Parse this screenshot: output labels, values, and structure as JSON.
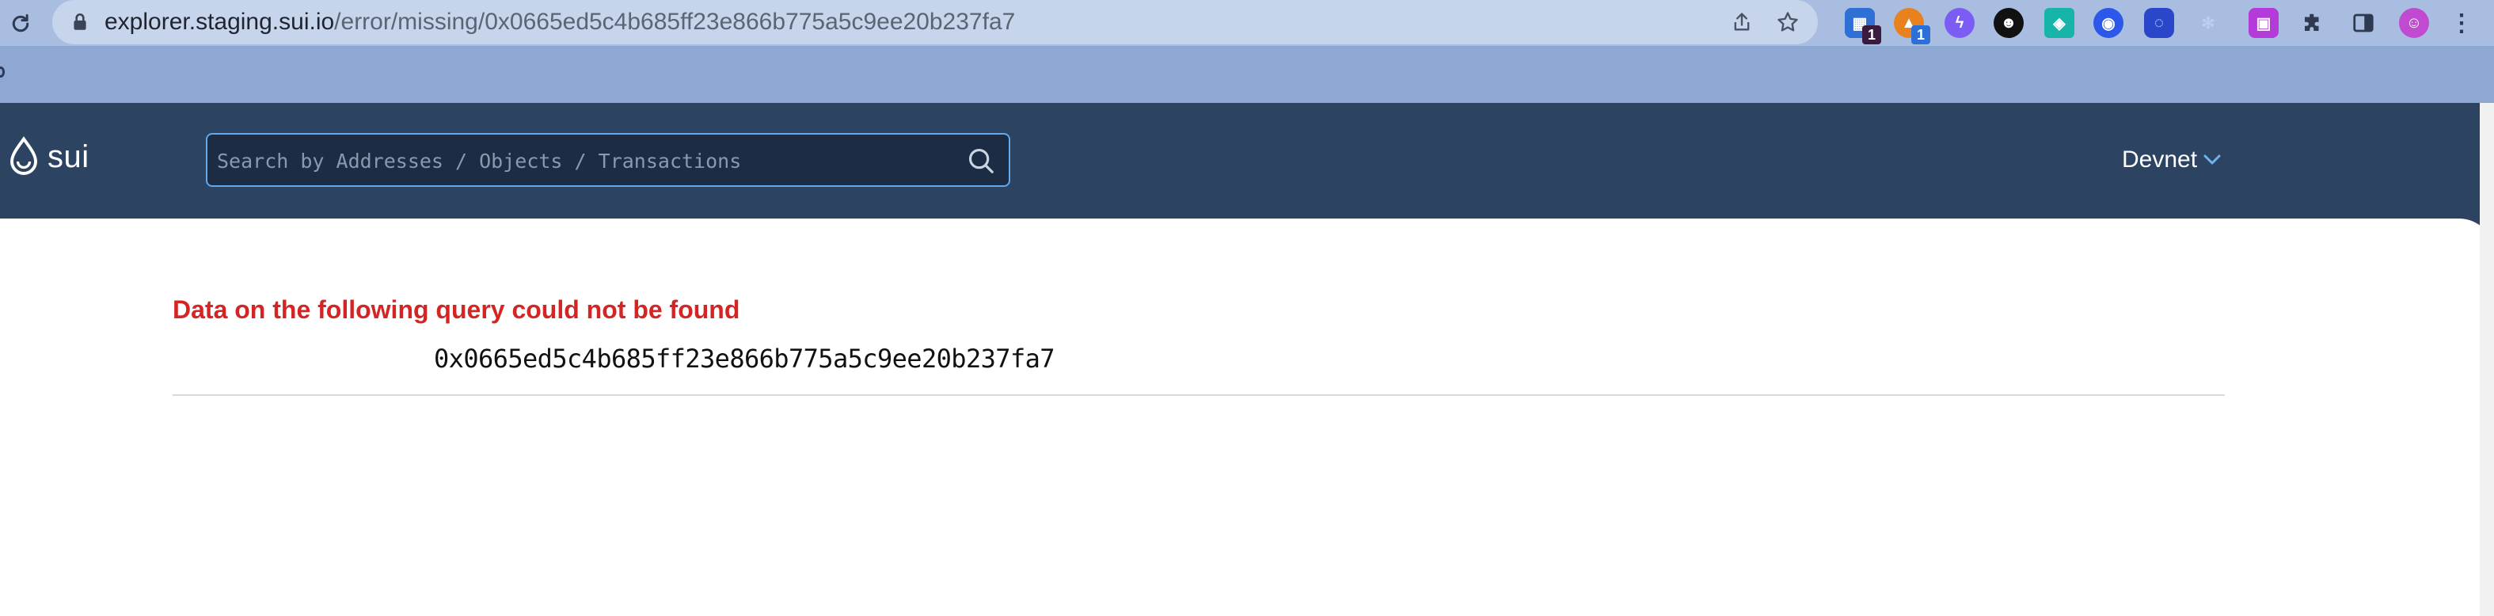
{
  "browser": {
    "url_host": "explorer.staging.sui.io",
    "url_path": "/error/missing/0x0665ed5c4b685ff23e866b775a5c9ee20b237fa7",
    "extensions": [
      {
        "name": "extension-grid-icon",
        "color": "#2f6fd6",
        "badge": "1",
        "badge_color": "#3a1a3f"
      },
      {
        "name": "metamask-fox-icon",
        "color": "#e8821e",
        "badge": "1",
        "badge_color": "#2b6fd8"
      },
      {
        "name": "lightning-icon",
        "color": "#7b5cf5"
      },
      {
        "name": "robot-icon",
        "color": "#111111"
      },
      {
        "name": "diamond-icon",
        "color": "#17b5a8"
      },
      {
        "name": "circle-target-icon",
        "color": "#2c57e8"
      },
      {
        "name": "chat-bubble-icon",
        "color": "#2a47c9"
      },
      {
        "name": "snowflake-icon",
        "color": "#bcd0ee"
      },
      {
        "name": "square-extension-icon",
        "color": "#b43ad9"
      }
    ]
  },
  "header": {
    "logo_text": "sui",
    "search_placeholder": "Search by Addresses / Objects / Transactions",
    "network_label": "Devnet"
  },
  "error": {
    "title": "Data on the following query could not be found",
    "query": "0x0665ed5c4b685ff23e866b775a5c9ee20b237fa7"
  },
  "colors": {
    "header_bg": "#2c4361",
    "error_red": "#d42525",
    "search_border": "#64a9ee"
  }
}
